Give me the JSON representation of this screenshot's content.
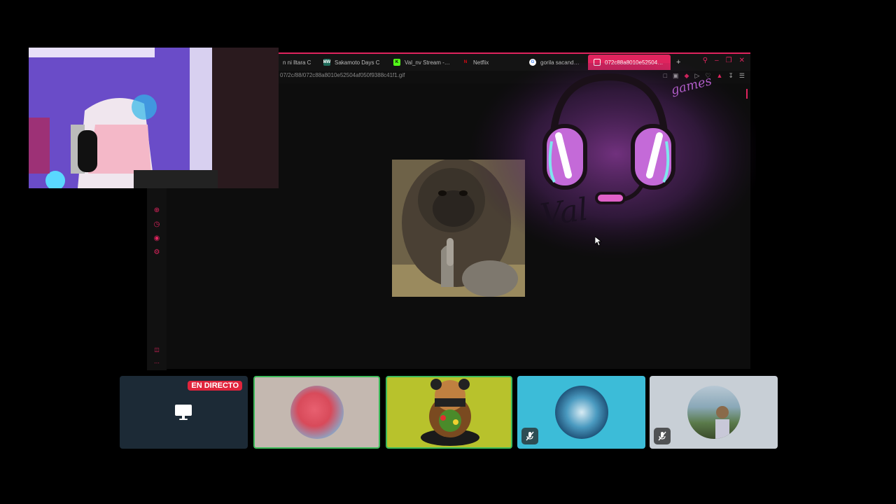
{
  "browser": {
    "tabs": [
      {
        "label": "n ni lltara C",
        "favicon": "generic-icon",
        "active": false
      },
      {
        "label": "Sakamoto Days C",
        "favicon": "mw-icon",
        "favicon_text": "MW",
        "active": false
      },
      {
        "label": "Val_nv Stream - W",
        "favicon": "kick-icon",
        "favicon_text": "K",
        "active": false
      },
      {
        "label": "Netflix",
        "favicon": "netflix-icon",
        "favicon_text": "N",
        "active": false
      },
      {
        "label": "gorila sacando el",
        "favicon": "google-icon",
        "favicon_text": "G",
        "active": false
      },
      {
        "label": "072c88a8010e52504af0",
        "favicon": "file-icon",
        "active": true
      }
    ],
    "new_tab_label": "+",
    "url": "07/2c/88/072c88a8010e52504af050f9388c41f1.gif",
    "accent_color": "#e0245e"
  },
  "overlay": {
    "logo_text": "Val",
    "logo_subtext": "games"
  },
  "call": {
    "tiles": [
      {
        "type": "screen-share",
        "badge": "EN DIRECTO"
      },
      {
        "type": "avatar",
        "speaking": true
      },
      {
        "type": "avatar",
        "speaking": true
      },
      {
        "type": "avatar",
        "muted": true
      },
      {
        "type": "avatar",
        "muted": true
      }
    ]
  }
}
